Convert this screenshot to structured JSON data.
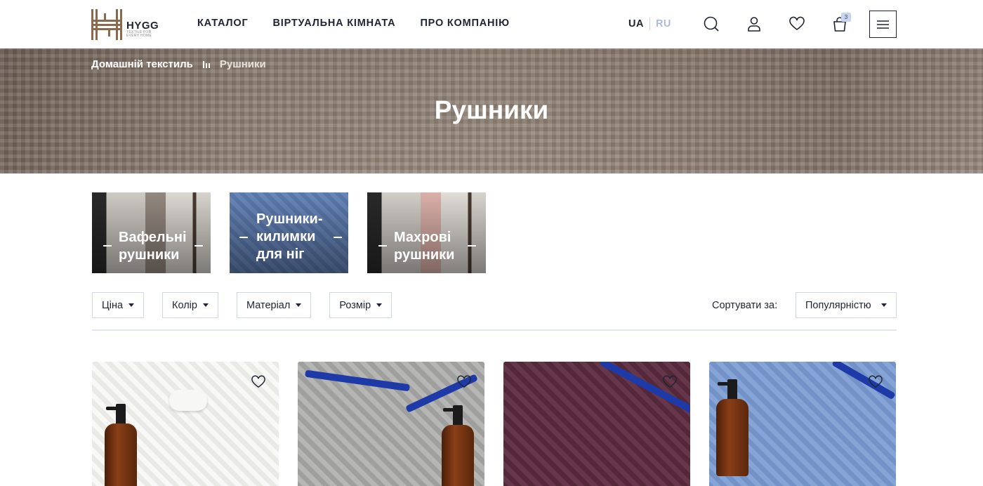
{
  "header": {
    "logo": {
      "word": "HYGG",
      "tagline": "TEXTILE FOR EVERY HOME"
    },
    "nav": [
      {
        "label": "КАТАЛОГ"
      },
      {
        "label": "ВІРТУАЛЬНА КІМНАТА"
      },
      {
        "label": "ПРО КОМПАНІЮ"
      }
    ],
    "languages": {
      "active": "UA",
      "inactive": "RU"
    },
    "icons": [
      "search-icon",
      "user-icon",
      "heart-icon",
      "bag-icon",
      "menu-icon"
    ],
    "cart_count": "3"
  },
  "hero": {
    "breadcrumb": {
      "home": "Домашній текстиль",
      "current": "Рушники"
    },
    "title": "Рушники"
  },
  "categories": [
    {
      "label_line1": "Вафельні",
      "label_line2": "рушники",
      "label_line3": ""
    },
    {
      "label_line1": "Рушники-",
      "label_line2": "килимки",
      "label_line3": "для ніг"
    },
    {
      "label_line1": "Махрові",
      "label_line2": "рушники",
      "label_line3": ""
    }
  ],
  "filters": [
    {
      "label": "Ціна"
    },
    {
      "label": "Колір"
    },
    {
      "label": "Матеріал"
    },
    {
      "label": "Розмір"
    }
  ],
  "sort": {
    "label": "Сортувати за:",
    "selected": "Популярністю"
  },
  "products": [
    {
      "color": "#f1f1ef",
      "favorite_icon": "heart-outline-icon"
    },
    {
      "color": "#a9a9a7",
      "favorite_icon": "heart-outline-icon"
    },
    {
      "color": "#5a2d3d",
      "favorite_icon": "heart-outline-icon"
    },
    {
      "color": "#7b9bcf",
      "favorite_icon": "heart-outline-icon"
    }
  ],
  "colors": {
    "text": "#1f2433",
    "inactive_lang": "#b0bbd9",
    "border": "#cfd6e8",
    "badge": "#c9d4ee"
  }
}
